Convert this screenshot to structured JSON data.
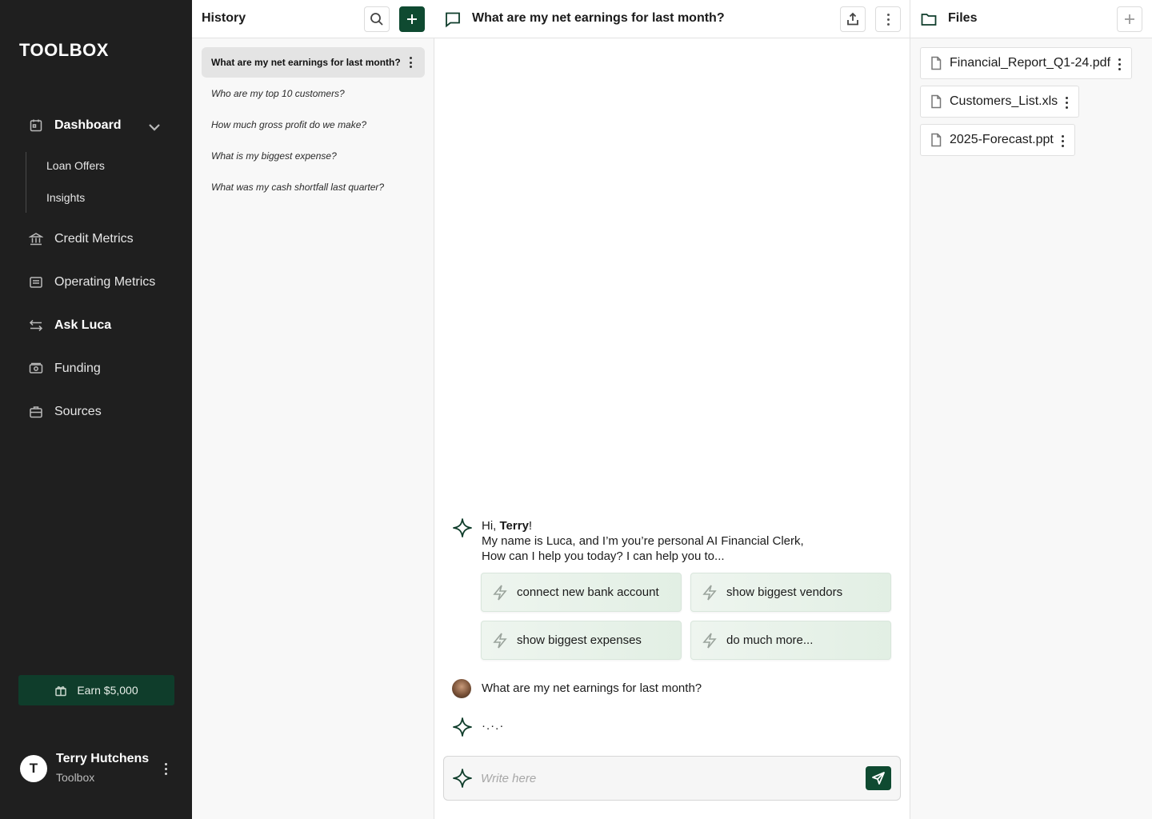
{
  "app": {
    "logo": "TOOLBOX"
  },
  "sidebar": {
    "items": [
      {
        "label": "Dashboard",
        "icon": "calendar-icon"
      },
      {
        "label": "Credit Metrics",
        "icon": "bank-icon"
      },
      {
        "label": "Operating Metrics",
        "icon": "list-icon"
      },
      {
        "label": "Ask Luca",
        "icon": "arrows-icon",
        "active": true
      },
      {
        "label": "Funding",
        "icon": "cash-icon"
      },
      {
        "label": "Sources",
        "icon": "briefcase-icon"
      }
    ],
    "subitems": [
      {
        "label": "Loan Offers"
      },
      {
        "label": "Insights"
      }
    ],
    "earn_label": "Earn $5,000",
    "user": {
      "initial": "T",
      "name": "Terry Hutchens",
      "org": "Toolbox"
    }
  },
  "history": {
    "title": "History",
    "items": [
      {
        "label": "What are my net earnings for last month?",
        "active": true
      },
      {
        "label": "Who are my top 10 customers?"
      },
      {
        "label": "How much gross profit do we make?"
      },
      {
        "label": "What is my biggest expense?"
      },
      {
        "label": "What was my cash shortfall last quarter?"
      }
    ]
  },
  "chat": {
    "title": "What are my net earnings for last month?",
    "greeting": {
      "hi": "Hi, ",
      "name": "Terry",
      "exclaim": "!",
      "line2": "My name is Luca, and I’m you’re personal AI Financial Clerk,",
      "line3": "How can I help you today? I can help you to..."
    },
    "suggestions": [
      {
        "label": "connect new bank account"
      },
      {
        "label": "show biggest vendors"
      },
      {
        "label": "show biggest expenses"
      },
      {
        "label": "do much more..."
      }
    ],
    "user_message": "What are my net earnings for last month?",
    "typing_indicator": "·.·.·",
    "composer": {
      "placeholder": "Write here",
      "value": ""
    }
  },
  "files": {
    "title": "Files",
    "items": [
      {
        "name": "Financial_Report_Q1-24.pdf"
      },
      {
        "name": "Customers_List.xls"
      },
      {
        "name": "2025-Forecast.ppt"
      }
    ]
  },
  "colors": {
    "sidebar_bg": "#1f1f1f",
    "accent": "#0f4a31",
    "earn_bg": "#0f3d2b",
    "chip_bg": "#e2efe4"
  }
}
